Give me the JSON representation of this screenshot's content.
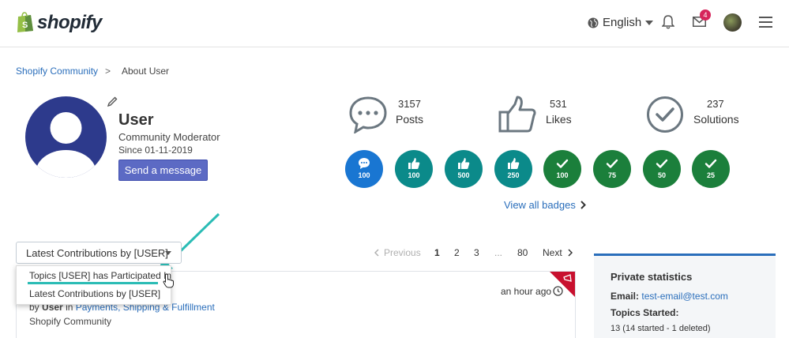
{
  "header": {
    "logo_text": "shopify",
    "language": "English",
    "notifications_count": "4"
  },
  "breadcrumb": {
    "root": "Shopify Community",
    "separator": ">",
    "current": "About User"
  },
  "profile": {
    "name": "User",
    "role": "Community Moderator",
    "since": "Since 01-11-2019",
    "send_message_label": "Send a message"
  },
  "stats": [
    {
      "value": "3157",
      "label": "Posts",
      "icon": "speech-bubble-icon"
    },
    {
      "value": "531",
      "label": "Likes",
      "icon": "thumbs-up-icon"
    },
    {
      "value": "237",
      "label": "Solutions",
      "icon": "checkmark-circle-icon"
    }
  ],
  "badges": [
    {
      "value": "100",
      "icon": "speech-bubble-icon",
      "color": "#1976d2"
    },
    {
      "value": "100",
      "icon": "thumbs-up-icon",
      "color": "#0b8a8a"
    },
    {
      "value": "500",
      "icon": "thumbs-up-icon",
      "color": "#0b8a8a"
    },
    {
      "value": "250",
      "icon": "thumbs-up-icon",
      "color": "#0b8a8a"
    },
    {
      "value": "100",
      "icon": "checkmark-icon",
      "color": "#1b7f3b"
    },
    {
      "value": "75",
      "icon": "checkmark-icon",
      "color": "#1b7f3b"
    },
    {
      "value": "50",
      "icon": "checkmark-icon",
      "color": "#1b7f3b"
    },
    {
      "value": "25",
      "icon": "checkmark-icon",
      "color": "#1b7f3b"
    }
  ],
  "view_all_badges": "View all badges",
  "contributions": {
    "selected": "Latest Contributions by [USER]",
    "options": [
      "Topics [USER] has Participated In",
      "Latest Contributions by [USER]"
    ]
  },
  "pagination": {
    "previous": "Previous",
    "pages": [
      "1",
      "2",
      "3",
      "...",
      "80"
    ],
    "next": "Next",
    "current_page": "1"
  },
  "post": {
    "time": "an hour ago",
    "by": "by",
    "author": "User",
    "in": "in",
    "board": "Payments, Shipping & Fulfillment",
    "community": "Shopify Community"
  },
  "private_stats": {
    "title": "Private statistics",
    "email_label": "Email:",
    "email": "test-email@test.com",
    "topics_label": "Topics Started:",
    "topics_value": "13 (14 started - 1 deleted)"
  },
  "colors": {
    "accent_link": "#2a6ebb",
    "button": "#5c6ac4",
    "teal_arrow": "#2bbcb5",
    "notification": "#d6245b",
    "avatar": "#2d3a8c"
  }
}
